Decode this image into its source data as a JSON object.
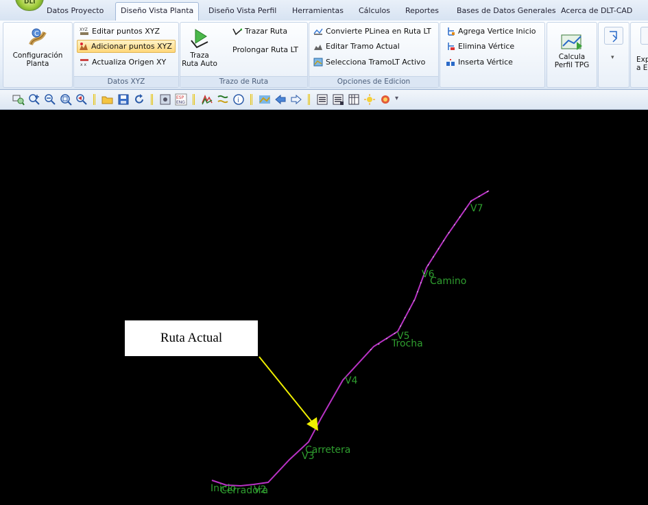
{
  "app": {
    "orb_label": "DLT"
  },
  "tabs": [
    {
      "label": "Datos Proyecto",
      "active": false
    },
    {
      "label": "Diseño Vista Planta",
      "active": true
    },
    {
      "label": "Diseño Vista Perfil",
      "active": false
    },
    {
      "label": "Herramientas",
      "active": false
    },
    {
      "label": "Cálculos",
      "active": false
    },
    {
      "label": "Reportes",
      "active": false
    },
    {
      "label": "Bases de Datos Generales",
      "active": false
    },
    {
      "label": "Acerca de DLT-CAD",
      "active": false
    }
  ],
  "ribbon": {
    "config": {
      "label_line1": "Configuración",
      "label_line2": "Planta"
    },
    "datos_xyz": {
      "group_label": "Datos XYZ",
      "editar": "Editar puntos XYZ",
      "adicionar": "Adicionar puntos XYZ",
      "actualiza": "Actualiza Origen XY"
    },
    "trazo": {
      "group_label": "Trazo de Ruta",
      "traza_line1": "Traza",
      "traza_line2": "Ruta Auto",
      "trazar": "Trazar Ruta",
      "prolongar": "Prolongar Ruta LT"
    },
    "edicion": {
      "group_label": "Opciones de Edicion",
      "convierte": "Convierte PLinea en Ruta LT",
      "editar_tramo": "Editar Tramo Actual",
      "selecciona": "Selecciona TramoLT Activo"
    },
    "vertices": {
      "agrega": "Agrega Vertice Inicio",
      "elimina": "Elimina Vértice",
      "inserta": "Inserta Vértice"
    },
    "perfil": {
      "label_line1": "Calcula",
      "label_line2": "Perfil TPG"
    },
    "export": {
      "label_line1": "Exp",
      "label_line2": "a E"
    }
  },
  "toolbar": {
    "icons": [
      "zoom-window-icon",
      "zoom-in-icon",
      "zoom-out-icon",
      "zoom-extents-icon",
      "zoom-previous-icon",
      "open-folder-icon",
      "save-icon",
      "refresh-icon",
      "settings-icon",
      "language-icon",
      "layers-icon",
      "curves-icon",
      "info-icon",
      "route-icon",
      "arrow-left-icon",
      "arrow-right-icon",
      "list-icon",
      "list-alt-icon",
      "table-icon",
      "light-icon",
      "flag-icon",
      "dropdown-icon"
    ],
    "language_label": "ESP/ENG"
  },
  "canvas": {
    "callout": "Ruta Actual",
    "labels": {
      "v7": "V7",
      "v6": "V6",
      "camino": "Camino",
      "v5": "V5",
      "trocha": "Trocha",
      "v4": "V4",
      "carretera": "Carretera",
      "v3": "V3",
      "inicio": "Inicio",
      "cerradora": "Cerradora",
      "v2": "V2"
    },
    "colors": {
      "route": "#b832c4",
      "labels": "#2f9e2f",
      "arrow": "#f0f000",
      "background": "#000000"
    }
  }
}
